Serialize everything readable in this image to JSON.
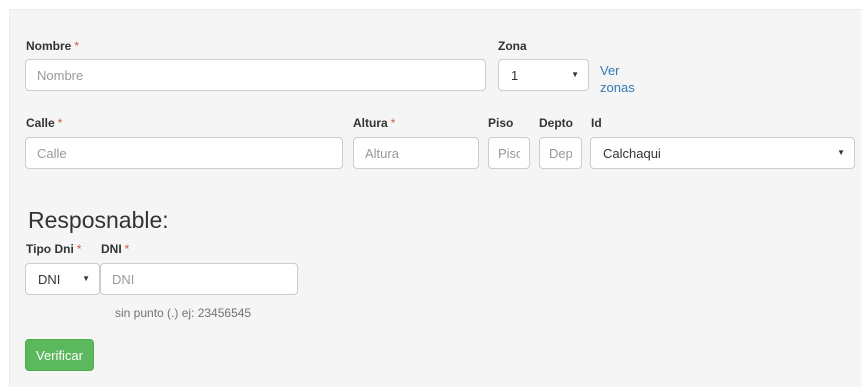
{
  "form": {
    "nombre": {
      "label": "Nombre",
      "required_mark": "*",
      "placeholder": "Nombre"
    },
    "zona": {
      "label": "Zona",
      "selected": "1",
      "link_label": "Ver zonas"
    },
    "calle": {
      "label": "Calle",
      "required_mark": "*",
      "placeholder": "Calle"
    },
    "altura": {
      "label": "Altura",
      "required_mark": "*",
      "placeholder": "Altura"
    },
    "piso": {
      "label": "Piso",
      "placeholder": "Piso"
    },
    "depto": {
      "label": "Depto",
      "placeholder": "Depto"
    },
    "id": {
      "label": "Id",
      "selected": "Calchaqui"
    }
  },
  "responsable": {
    "title": "Resposnable:",
    "tipo_dni": {
      "label": "Tipo Dni",
      "required_mark": "*",
      "selected": "DNI"
    },
    "dni": {
      "label": "DNI",
      "required_mark": "*",
      "placeholder": "DNI",
      "help": "sin punto (.) ej: 23456545"
    },
    "verify_button": "Verificar"
  },
  "icons": {
    "select_caret": "caret-down-icon"
  },
  "colors": {
    "panel_bg": "#f5f5f5",
    "required": "#d9534f",
    "link": "#337ab7",
    "success_button": "#5cb85c",
    "input_border": "#cccccc"
  }
}
